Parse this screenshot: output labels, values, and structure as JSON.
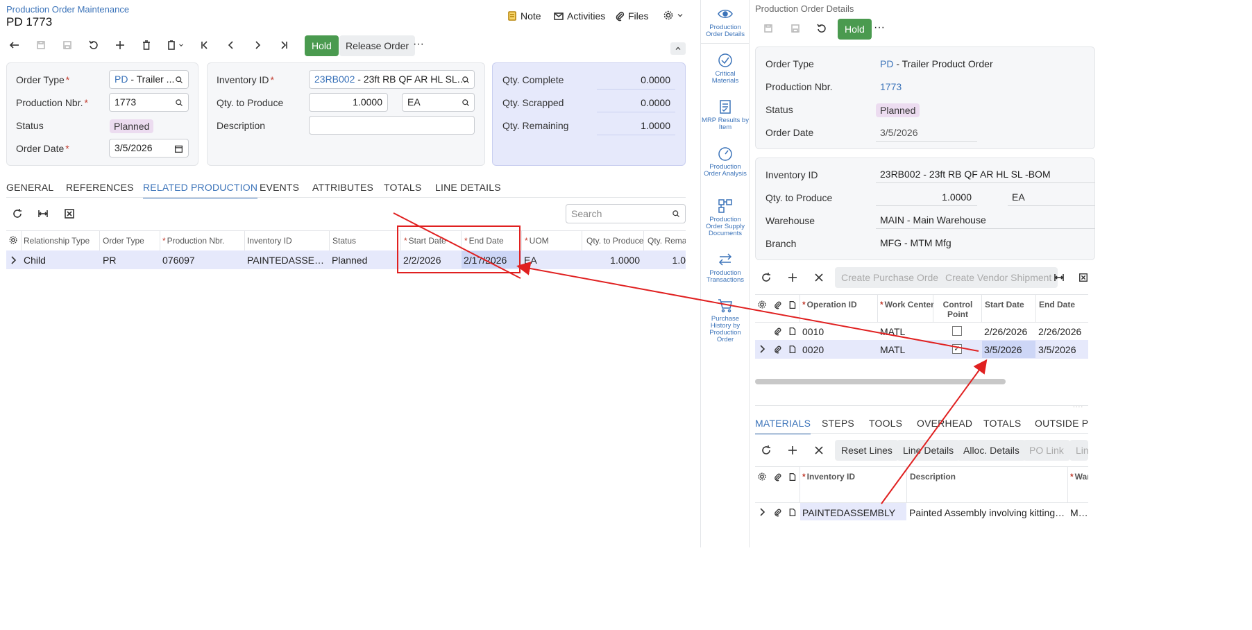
{
  "header": {
    "breadcrumb": "Production Order Maintenance",
    "title": "PD 1773",
    "note": "Note",
    "activities": "Activities",
    "files": "Files"
  },
  "toolbar": {
    "hold": "Hold",
    "release_order": "Release Order",
    "more": "···"
  },
  "form": {
    "order_type_label": "Order Type",
    "order_type_code": "PD",
    "order_type_desc": " - Trailer ...",
    "production_nbr_label": "Production Nbr.",
    "production_nbr": "1773",
    "status_label": "Status",
    "status": "Planned",
    "order_date_label": "Order Date",
    "order_date": "3/5/2026",
    "inventory_id_label": "Inventory ID",
    "inventory_id_code": "23RB002",
    "inventory_id_desc": " - 23ft RB QF AR HL SL -B...",
    "qty_to_produce_label": "Qty. to Produce",
    "qty_to_produce": "1.0000",
    "uom": "EA",
    "description_label": "Description",
    "description": "",
    "qty_complete_label": "Qty. Complete",
    "qty_complete": "0.0000",
    "qty_scrapped_label": "Qty. Scrapped",
    "qty_scrapped": "0.0000",
    "qty_remaining_label": "Qty. Remaining",
    "qty_remaining": "1.0000"
  },
  "tabs": [
    "GENERAL",
    "REFERENCES",
    "RELATED PRODUCTION",
    "EVENTS",
    "ATTRIBUTES",
    "TOTALS",
    "LINE DETAILS"
  ],
  "grid": {
    "search_placeholder": "Search",
    "columns": [
      "Relationship Type",
      "Order Type",
      "Production Nbr.",
      "Inventory ID",
      "Status",
      "Start Date",
      "End Date",
      "UOM",
      "Qty. to Produce",
      "Qty. Remai"
    ],
    "row": {
      "relationship_type": "Child",
      "order_type": "PR",
      "production_nbr": "076097",
      "inventory_id": "PAINTEDASSEMB...",
      "status": "Planned",
      "start_date": "2/2/2026",
      "end_date": "2/17/2026",
      "uom": "EA",
      "qty_to_produce": "1.0000",
      "qty_remaining": "1.0"
    }
  },
  "sidebar": {
    "items": [
      "Production Order Details",
      "Critical Materials",
      "MRP Results by Item",
      "Production Order Analysis",
      "Production Order Supply Documents",
      "Production Transactions",
      "Purchase History by Production Order"
    ]
  },
  "details": {
    "title": "Production Order Details",
    "hold": "Hold",
    "more": "···",
    "order_type_label": "Order Type",
    "order_type_code": "PD",
    "order_type_desc": " - Trailer Product Order",
    "production_nbr_label": "Production Nbr.",
    "production_nbr": "1773",
    "status_label": "Status",
    "status": "Planned",
    "order_date_label": "Order Date",
    "order_date": "3/5/2026",
    "inventory_id_label": "Inventory ID",
    "inventory_id": "23RB002 - 23ft RB QF AR HL SL -BOM",
    "qty_to_produce_label": "Qty. to Produce",
    "qty_to_produce": "1.0000",
    "uom": "EA",
    "warehouse_label": "Warehouse",
    "warehouse": "MAIN - Main Warehouse",
    "branch_label": "Branch",
    "branch": "MFG - MTM Mfg",
    "create_po": "Create Purchase Order",
    "create_vendor_shipment": "Create Vendor Shipment",
    "ops_columns": [
      "Operation ID",
      "Work Center",
      "Control Point",
      "Start Date",
      "End Date"
    ],
    "ops_rows": [
      {
        "operation_id": "0010",
        "work_center": "MATL",
        "start_date": "2/26/2026",
        "end_date": "2/26/2026"
      },
      {
        "operation_id": "0020",
        "work_center": "MATL",
        "start_date": "3/5/2026",
        "end_date": "3/5/2026"
      }
    ],
    "bottom_tabs": [
      "MATERIALS",
      "STEPS",
      "TOOLS",
      "OVERHEAD",
      "TOTALS",
      "OUTSIDE PRO"
    ],
    "reset_lines": "Reset Lines",
    "line_details": "Line Details",
    "alloc_details": "Alloc. Details",
    "po_link": "PO Link",
    "lin": "Lin",
    "mat_columns": [
      "Inventory ID",
      "Description",
      "War"
    ],
    "mat_row": {
      "inventory_id": "PAINTEDASSEMBLY",
      "description": "Painted Assembly involving kitting, wel...",
      "warehouse": "MAIN"
    }
  },
  "colors": {
    "accent": "#3b73b9",
    "hold_green": "#4a9a4f",
    "annotation_red": "#e02020",
    "selected_row": "#e6e9fb"
  }
}
